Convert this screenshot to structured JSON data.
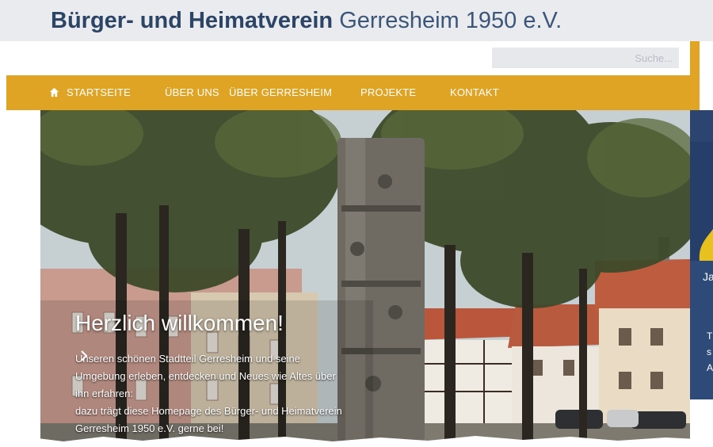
{
  "header": {
    "title_strong": "Bürger- und Heimatverein",
    "title_light": "Gerresheim 1950 e.V."
  },
  "search": {
    "placeholder": "Suche..."
  },
  "nav": {
    "items": [
      {
        "label": "STARTSEITE",
        "icon": "home-icon"
      },
      {
        "label": "ÜBER UNS"
      },
      {
        "label": "ÜBER GERRESHEIM"
      },
      {
        "label": "PROJEKTE"
      },
      {
        "label": "KONTAKT"
      }
    ]
  },
  "hero": {
    "title": "Herzlich willkommen!",
    "lines": [
      "Unseren schönen Stadtteil Gerresheim und seine",
      "Umgebung erleben, entdecken und Neues wie Altes über",
      "ihn erfahren:",
      "dazu trägt diese Homepage des Bürger- und Heimatverein",
      "Gerresheim 1950 e.V. gerne bei!"
    ]
  },
  "right_partial": {
    "letter1": "Ja",
    "letter2": "T",
    "letter3": "s",
    "letter4": "A"
  },
  "colors": {
    "nav_bg": "#e0a424",
    "title_blue": "#2c4466",
    "header_bg": "#e9ebee"
  }
}
